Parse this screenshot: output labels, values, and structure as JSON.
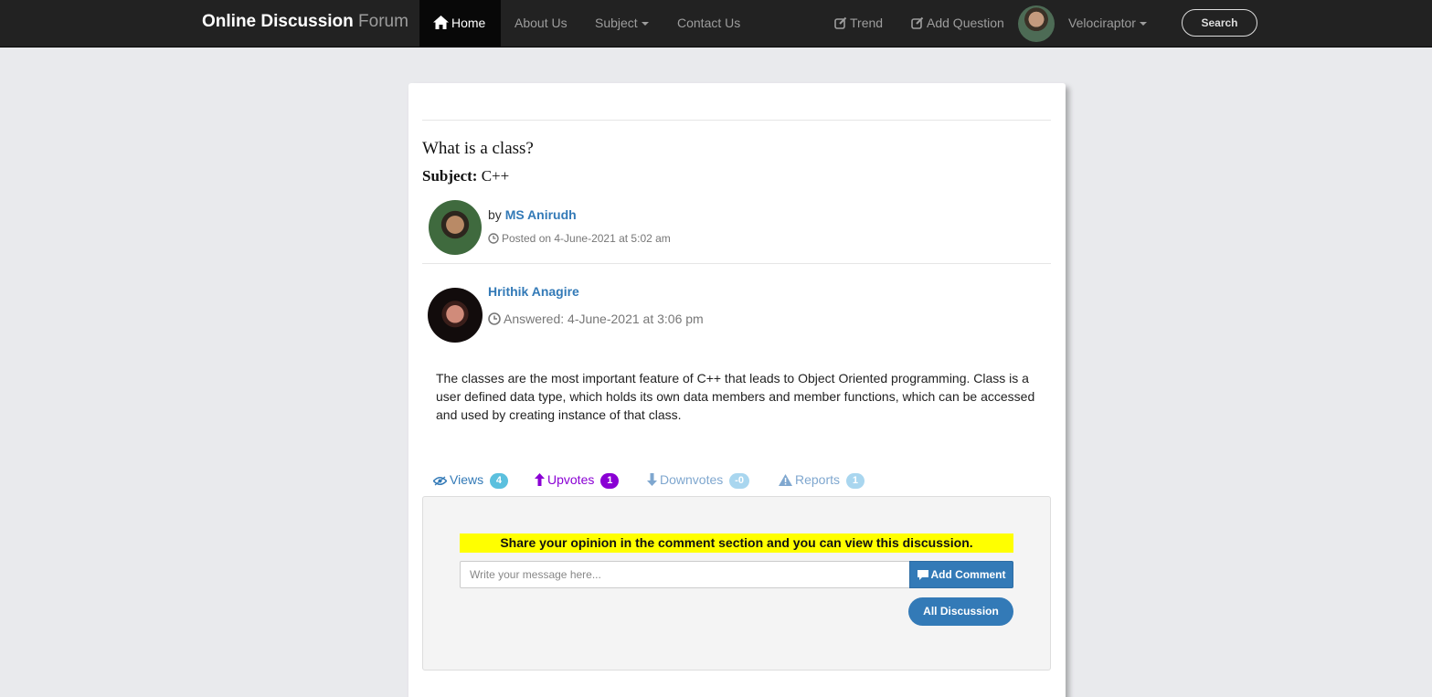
{
  "navbar": {
    "brand_bold": "Online Discussion",
    "brand_light": "Forum",
    "home": "Home",
    "about": "About Us",
    "subject": "Subject",
    "contact": "Contact Us",
    "trend": "Trend",
    "add_question": "Add Question",
    "user": "Velociraptor",
    "search": "Search"
  },
  "question": {
    "title": "What is a class?",
    "subject_label": "Subject:",
    "subject": "C++",
    "by": "by",
    "author": "MS Anirudh",
    "posted": "Posted on 4-June-2021 at 5:02 am"
  },
  "answer": {
    "author": "Hrithik Anagire",
    "answered": "Answered: 4-June-2021 at 3:06 pm",
    "text": "The classes are the most important feature of C++ that leads to Object Oriented programming. Class is a user defined data type, which holds its own data members and member functions, which can be accessed and used by creating instance of that class."
  },
  "stats": {
    "views_label": "Views",
    "views": "4",
    "upvotes_label": "Upvotes",
    "upvotes": "1",
    "downvotes_label": "Downvotes",
    "downvotes": "-0",
    "reports_label": "Reports",
    "reports": "1"
  },
  "comments": {
    "notice": "Share your opinion in the comment section and you can view this discussion.",
    "placeholder": "Write your message here...",
    "add_button": "Add Comment",
    "all_button": "All Discussion"
  },
  "colors": {
    "navbar": "#222222",
    "link": "#337ab7",
    "upvote": "#8a00d4",
    "notice": "#ffff00"
  }
}
